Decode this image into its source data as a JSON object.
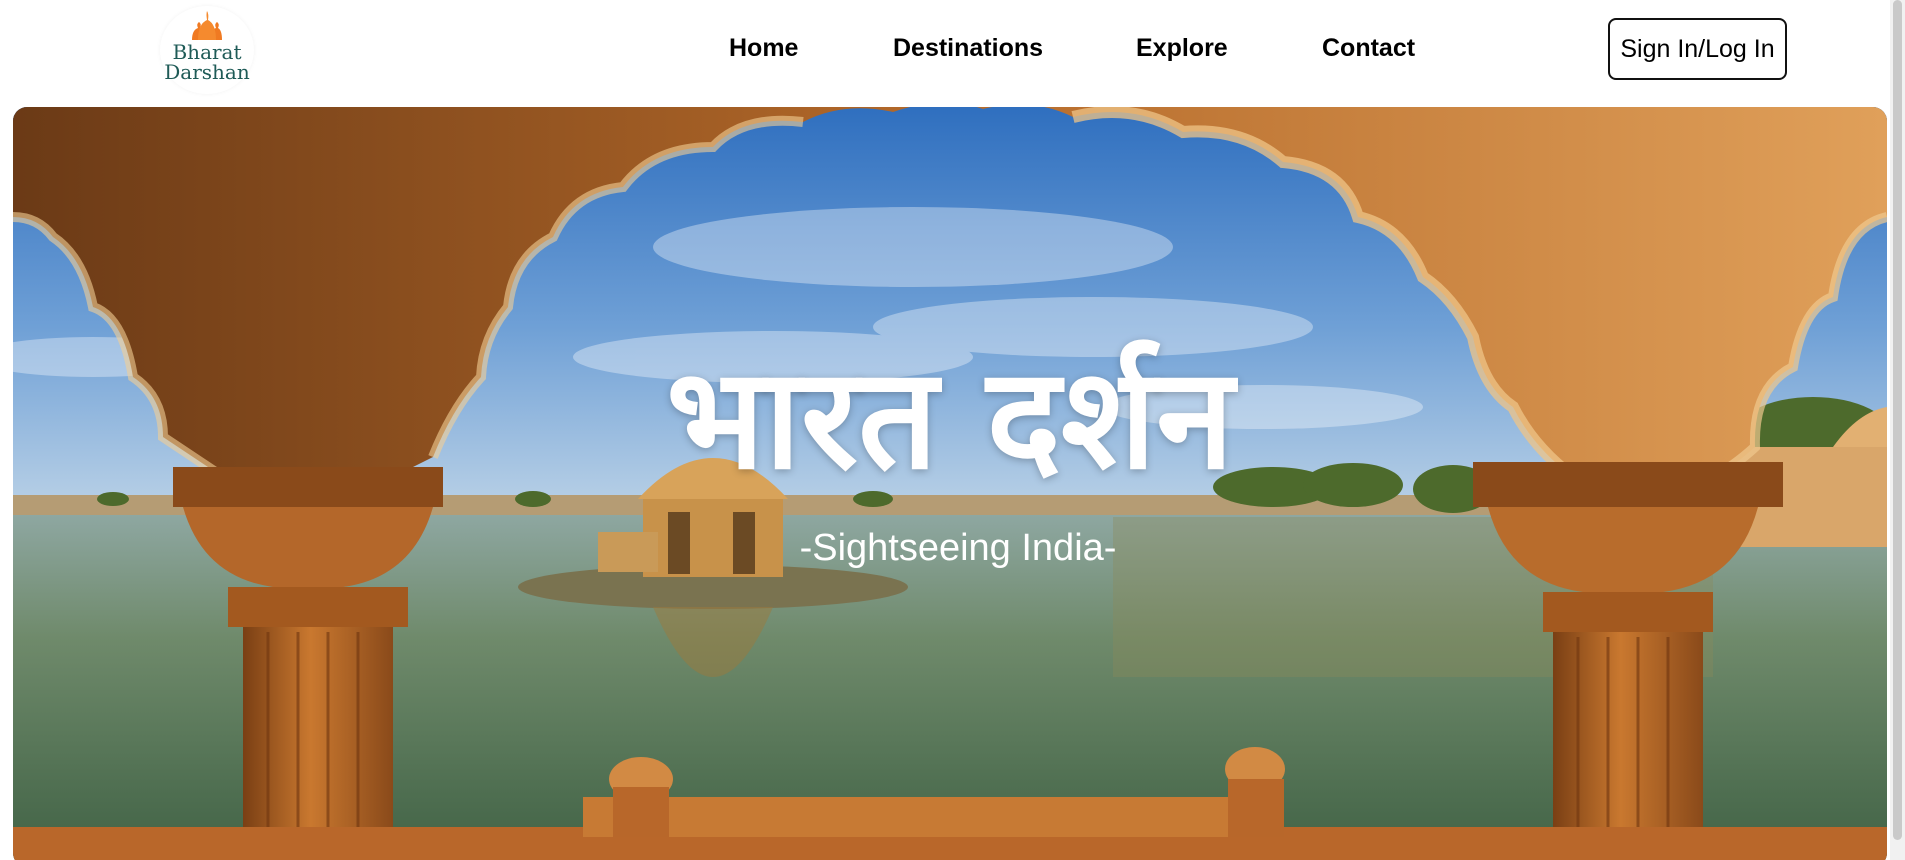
{
  "brand": {
    "logo_line1": "Bharat",
    "logo_line2": "Darshan",
    "logo_color": "#1f5b57",
    "logo_icon_color": "#f07a22"
  },
  "nav": {
    "items": [
      {
        "label": "Home"
      },
      {
        "label": "Destinations"
      },
      {
        "label": "Explore"
      },
      {
        "label": "Contact"
      }
    ]
  },
  "auth": {
    "signin_label": "Sign In/Log In"
  },
  "hero": {
    "title": "भारत दर्शन",
    "subtitle": "-Sightseeing India-"
  },
  "colors": {
    "sky": "#3f7fc9",
    "water": "#5d7f62",
    "sandstone": "#c77a34",
    "text": "#000000"
  }
}
